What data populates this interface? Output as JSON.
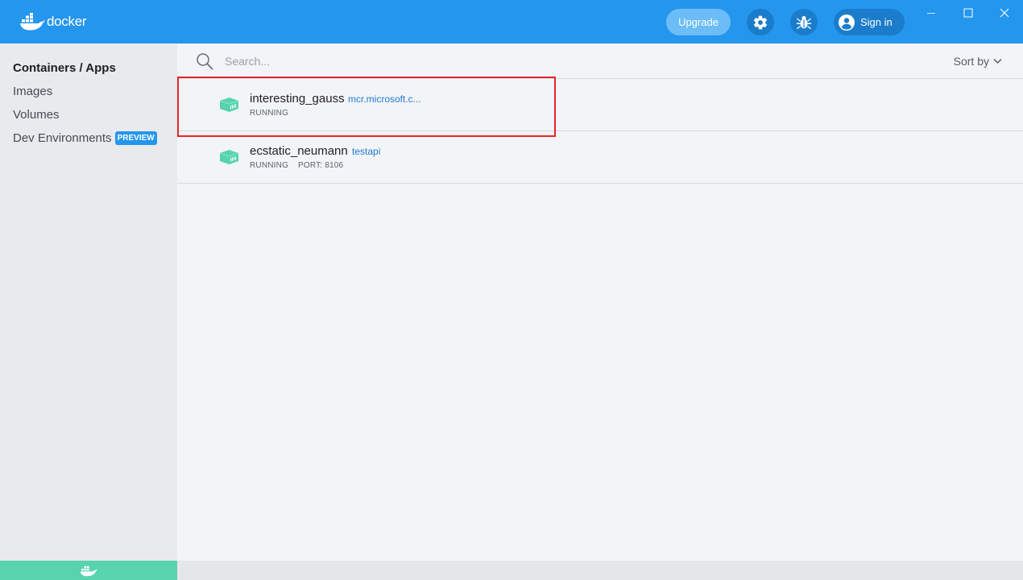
{
  "app": {
    "logo_text": "docker"
  },
  "header": {
    "upgrade_label": "Upgrade",
    "settings_icon": "gear-icon",
    "troubleshoot_icon": "bug-icon",
    "signin_label": "Sign in",
    "window_controls": [
      "minimize",
      "maximize",
      "close"
    ]
  },
  "sidebar": {
    "items": [
      {
        "label": "Containers / Apps",
        "active": true
      },
      {
        "label": "Images"
      },
      {
        "label": "Volumes"
      },
      {
        "label": "Dev Environments",
        "badge": "PREVIEW"
      }
    ]
  },
  "search": {
    "placeholder": "Search...",
    "sort_label": "Sort by"
  },
  "containers": [
    {
      "name": "interesting_gauss",
      "image": "mcr.microsoft.c...",
      "status": "RUNNING"
    },
    {
      "name": "ecstatic_neumann",
      "image": "testapi",
      "status": "RUNNING",
      "port": "PORT: 8106"
    }
  ],
  "colors": {
    "brand": "#2496ed",
    "running": "#57d3ad",
    "highlight": "#e3262a"
  }
}
